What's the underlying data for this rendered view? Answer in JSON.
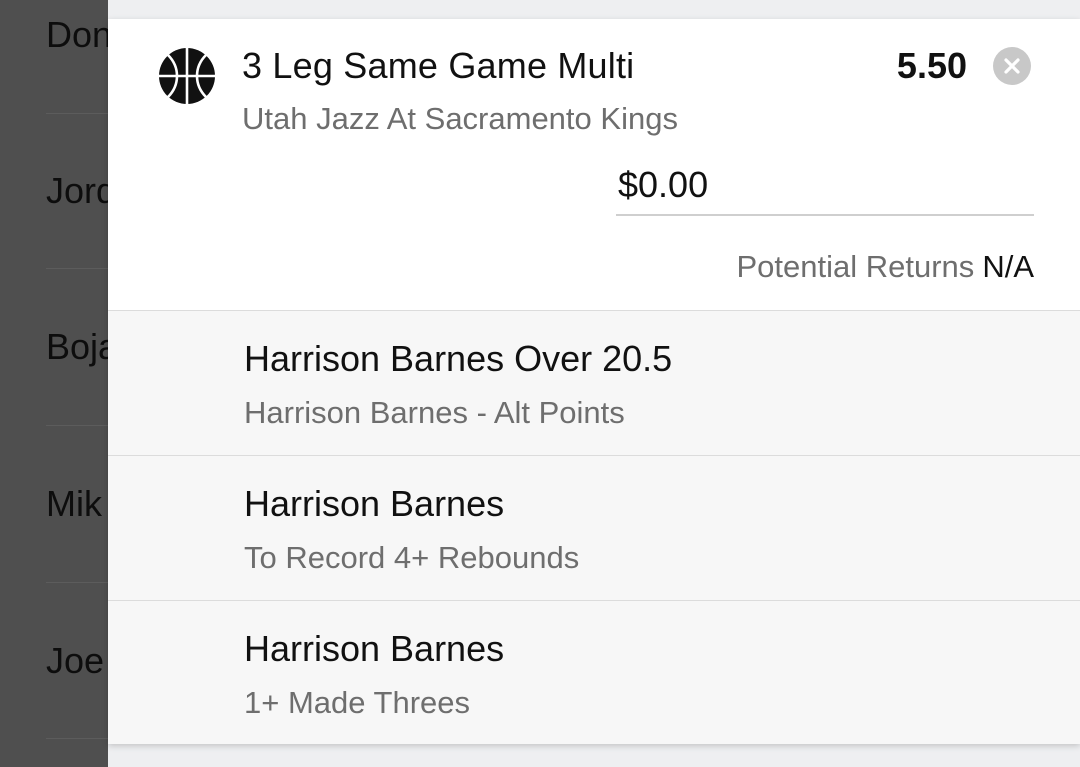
{
  "background_list": {
    "items": [
      "Don",
      "Jord",
      "Boja",
      "Mik",
      "Joe"
    ]
  },
  "bet": {
    "icon": "basketball-icon",
    "title": "3 Leg Same Game Multi",
    "event": "Utah Jazz At Sacramento Kings",
    "odds": "5.50",
    "close_icon": "close-icon",
    "stake_value": "$0.00",
    "returns_label": "Potential Returns",
    "returns_value": "N/A"
  },
  "legs": [
    {
      "title": "Harrison Barnes Over 20.5",
      "market": "Harrison Barnes - Alt Points"
    },
    {
      "title": "Harrison Barnes",
      "market": "To Record 4+ Rebounds"
    },
    {
      "title": "Harrison Barnes",
      "market": "1+ Made Threes"
    }
  ]
}
